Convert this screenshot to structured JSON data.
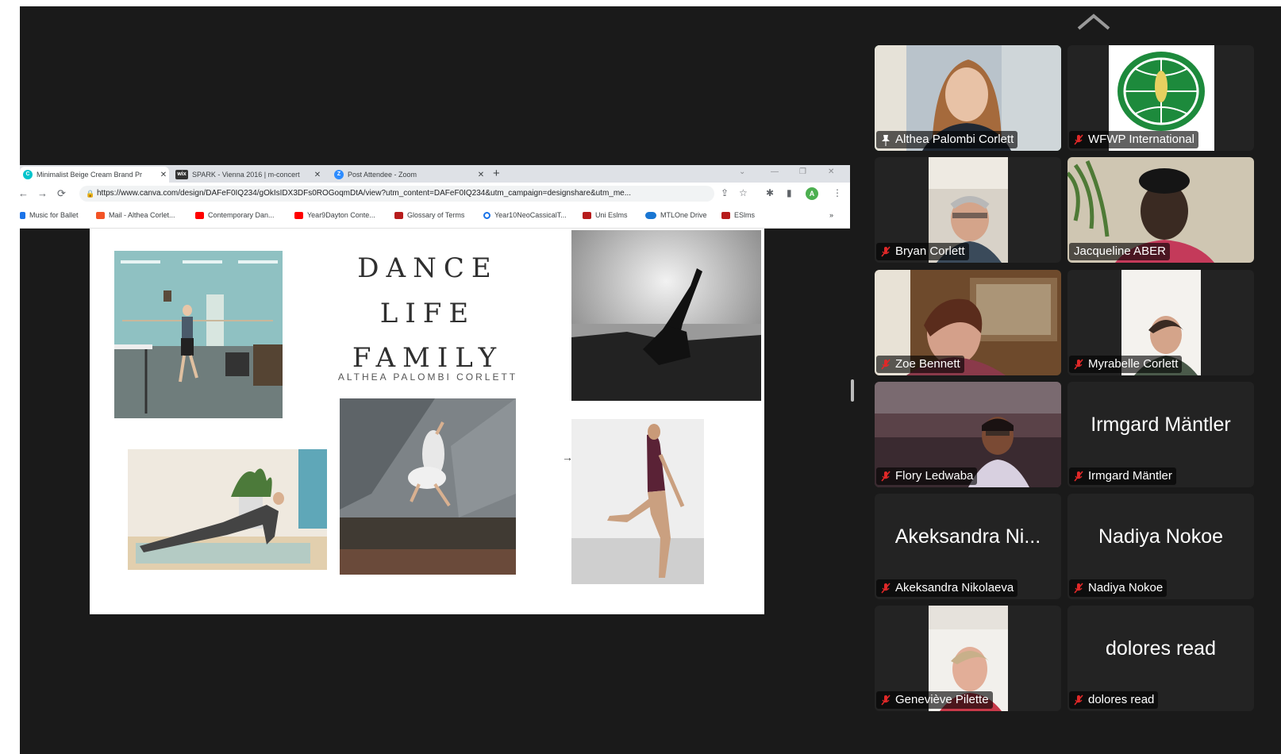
{
  "browser": {
    "tabs": [
      {
        "title": "Minimalist Beige Cream Brand Pr",
        "favicon": "canva-icon",
        "active": true
      },
      {
        "title": "SPARK - Vienna 2016 | m-concert",
        "favicon": "wix-icon",
        "active": false
      },
      {
        "title": "Post Attendee - Zoom",
        "favicon": "zoom-icon",
        "active": false
      }
    ],
    "url": "https://www.canva.com/design/DAFeF0IQ234/gOkIsIDX3DFs0ROGoqmDtA/view?utm_content=DAFeF0IQ234&utm_campaign=designshare&utm_me...",
    "profile_initial": "A",
    "bookmarks": [
      {
        "label": "Music for Ballet",
        "color": "#1a73e8"
      },
      {
        "label": "Mail - Althea Corlet...",
        "color": "#f35325"
      },
      {
        "label": "Contemporary Dan...",
        "color": "#ff0000"
      },
      {
        "label": "Year9Dayton Conte...",
        "color": "#ff0000"
      },
      {
        "label": "Glossary of Terms",
        "color": "#b71c1c"
      },
      {
        "label": "Year10NeoCassicalT...",
        "color": "#1a73e8"
      },
      {
        "label": "Uni Eslms",
        "color": "#b71c1c"
      },
      {
        "label": "MTLOne Drive",
        "color": "#1976d2"
      },
      {
        "label": "ESlms",
        "color": "#b71c1c"
      }
    ],
    "bookmarks_overflow": "»"
  },
  "canva": {
    "title_line1": "DANCE",
    "title_line2": "LIFE",
    "title_line3": "FAMILY",
    "subtitle": "ALTHEA PALOMBI CORLETT"
  },
  "participants": [
    {
      "name": "Althea Palombi Corlett",
      "video": true,
      "muted": false,
      "speaking": true,
      "pinned": true
    },
    {
      "name": "WFWP International",
      "video": true,
      "muted": true
    },
    {
      "name": "Bryan Corlett",
      "video": true,
      "muted": true
    },
    {
      "name": "Jacqueline ABER",
      "video": true,
      "muted": false
    },
    {
      "name": "Zoe Bennett",
      "video": true,
      "muted": true
    },
    {
      "name": "Myrabelle Corlett",
      "video": true,
      "muted": true
    },
    {
      "name": "Flory Ledwaba",
      "video": true,
      "muted": true
    },
    {
      "name": "Irmgard Mäntler",
      "display": "Irmgard Mäntler",
      "video": false,
      "muted": true
    },
    {
      "name": "Akeksandra Nikolaeva",
      "display": "Akeksandra Ni...",
      "video": false,
      "muted": true
    },
    {
      "name": "Nadiya Nokoe",
      "display": "Nadiya Nokoe",
      "video": false,
      "muted": true
    },
    {
      "name": "Geneviève Pilette",
      "video": true,
      "muted": true
    },
    {
      "name": "dolores read",
      "display": "dolores read",
      "video": false,
      "muted": true
    }
  ],
  "colors": {
    "speaking_border": "#4fc14f",
    "muted_mic": "#e02828",
    "tile_bg": "#232323",
    "window_bg": "#1a1a1a"
  }
}
